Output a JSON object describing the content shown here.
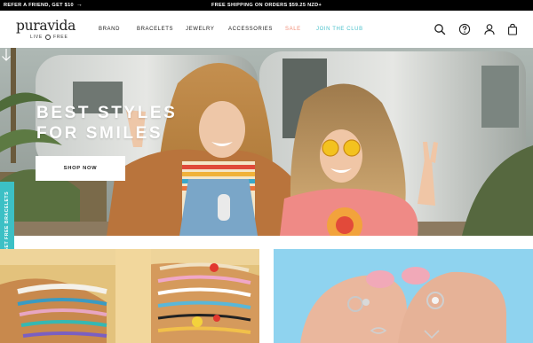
{
  "announcement": {
    "refer": "REFER A FRIEND, GET $10",
    "refer_arrow": "→",
    "shipping": "FREE SHIPPING ON ORDERS $59.25 NZD+"
  },
  "header": {
    "logo_word": "puravida",
    "logo_tag_left": "LIVE",
    "logo_tag_right": "FREE",
    "nav": {
      "brand": "BRAND",
      "bracelets": "BRACELETS",
      "jewelry": "JEWELRY",
      "accessories": "ACCESSORIES",
      "sale": "SALE",
      "club": "JOIN THE CLUB"
    },
    "icons": [
      "search-icon",
      "help-icon",
      "account-icon",
      "bag-icon"
    ]
  },
  "hero": {
    "title_line1": "BEST STYLES",
    "title_line2": "FOR SMILES",
    "cta": "SHOP NOW"
  },
  "side_tab": {
    "label": "GET FREE BRACELETS"
  },
  "colors": {
    "announcement_bg": "#000000",
    "sale": "#f28c76",
    "club": "#4cc2cc",
    "side_tab": "#3cc0c5"
  }
}
